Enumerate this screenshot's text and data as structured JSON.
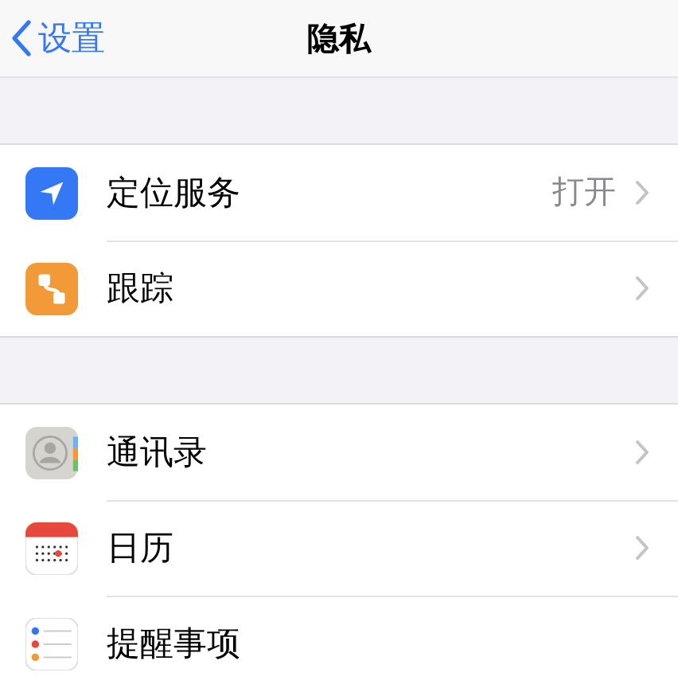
{
  "nav_bar": {
    "back": "设置",
    "title": "隐私"
  },
  "groups": [
    {
      "rows": [
        {
          "label": "定位服务",
          "value": "打开",
          "chevron": true
        },
        {
          "label": "跟踪",
          "chevron": true
        }
      ]
    },
    {
      "rows": [
        {
          "label": "通讯录",
          "chevron": true
        },
        {
          "label": "日历",
          "chevron": true
        },
        {
          "label": "提醒事项",
          "chevron": false
        }
      ]
    }
  ]
}
